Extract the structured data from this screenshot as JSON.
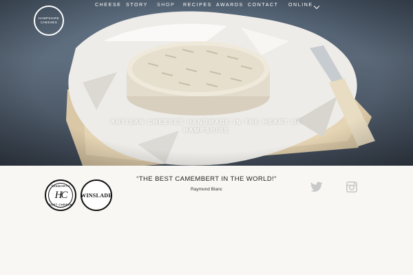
{
  "brand": {
    "logo_text": "HAMPSHIRE\nCHEESES"
  },
  "nav": {
    "items": [
      {
        "label": "CHEESE"
      },
      {
        "label": "STORY"
      },
      {
        "label": "SHOP"
      },
      {
        "label": "RECIPES"
      },
      {
        "label": "AWARDS"
      },
      {
        "label": "CONTACT"
      },
      {
        "label": "ONLINE"
      }
    ],
    "dropdown_icon": "chevron-down-icon"
  },
  "hero": {
    "tagline": "ARTISAN CHEESES HANDMADE IN THE HEART OF HAMPSHIRE"
  },
  "badges": {
    "huntsworth": {
      "top": "TUNWORTH",
      "monogram": "HC",
      "bottom": "SOFT CHEESE"
    },
    "winslade": {
      "label": "WINSLADE"
    }
  },
  "testimonial": {
    "quote": "“THE BEST CAMEMBERT IN THE WORLD!”",
    "author": "Raymond Blanc"
  },
  "social": {
    "twitter_icon": "twitter-icon",
    "instagram_icon": "instagram-icon",
    "icon_color": "#c9c9c9"
  },
  "colors": {
    "background": "#f8f7f3",
    "hero_overlay_text": "#ffffff"
  }
}
